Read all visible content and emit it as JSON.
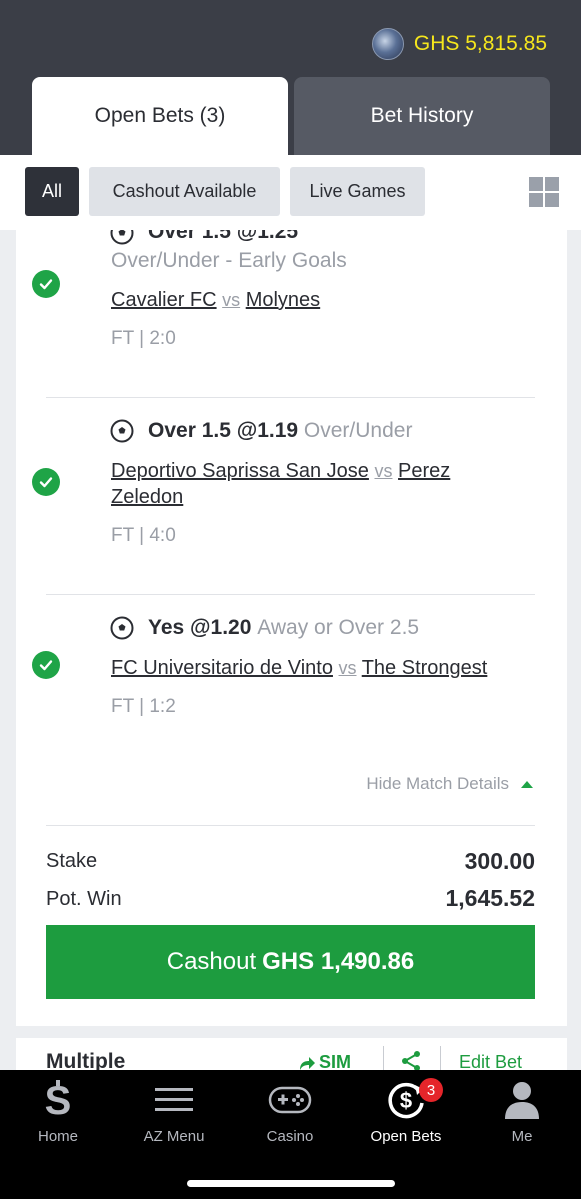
{
  "header": {
    "balance": "GHS 5,815.85",
    "tabs": [
      {
        "label": "Open Bets (3)",
        "active": true
      },
      {
        "label": "Bet History",
        "active": false
      }
    ]
  },
  "filters": {
    "chips": [
      {
        "label": "All",
        "active": true
      },
      {
        "label": "Cashout Available",
        "active": false
      },
      {
        "label": "Live Games",
        "active": false
      }
    ],
    "grid_icon": "grid-view-icon"
  },
  "bet": {
    "selections": [
      {
        "pick": "Over 1.5 @1.25",
        "market": "Over/Under  -  Early Goals",
        "home": "Cavalier FC",
        "vs": "vs",
        "away": "Molynes",
        "result": "FT | 2:0",
        "status": "won"
      },
      {
        "pick": "Over 1.5 @1.19",
        "market": "Over/Under",
        "home": "Deportivo Saprissa San Jose",
        "vs": "vs",
        "away": "Perez Zeledon",
        "result": "FT | 4:0",
        "status": "won"
      },
      {
        "pick": "Yes @1.20",
        "market": "Away or Over 2.5",
        "home": "FC Universitario de Vinto",
        "vs": "vs",
        "away": "The Strongest",
        "result": "FT | 1:2",
        "status": "won"
      }
    ],
    "hide_details": "Hide Match Details",
    "stake_label": "Stake",
    "stake_value": "300.00",
    "potwin_label": "Pot. Win",
    "potwin_value": "1,645.52",
    "cashout_label": "Cashout",
    "cashout_amount": "GHS 1,490.86"
  },
  "next_bet": {
    "title": "Multiple",
    "sim_label": "SIM",
    "edit_label": "Edit Bet"
  },
  "nav": {
    "items": [
      {
        "label": "Home",
        "icon": "home-logo-icon"
      },
      {
        "label": "AZ Menu",
        "icon": "menu-icon"
      },
      {
        "label": "Casino",
        "icon": "gamepad-icon"
      },
      {
        "label": "Open Bets",
        "icon": "open-bets-icon",
        "badge": "3",
        "active": true
      },
      {
        "label": "Me",
        "icon": "user-icon"
      }
    ]
  },
  "colors": {
    "header": "#3b3e47",
    "balance": "#f5e61d",
    "accent_green": "#1d9c3f",
    "badge_red": "#e5252a"
  }
}
